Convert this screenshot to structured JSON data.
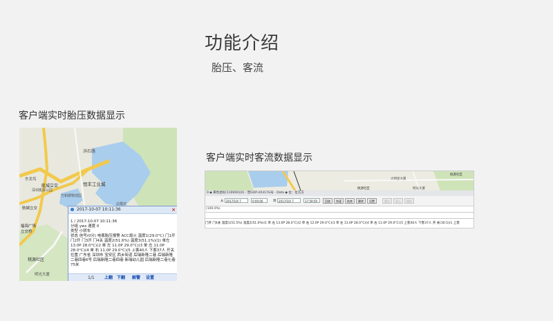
{
  "page": {
    "title": "功能介绍",
    "subtitle": "胎压、客流"
  },
  "left_panel": {
    "caption": "客户端实时胎压数据显示",
    "map_labels": [
      "洪石路",
      "东龙坞",
      "航城立交",
      "恒丰工业城",
      "万和顺物流园",
      "深圳桃源公园",
      "白鹭坊",
      "航城立交",
      "福海广场",
      "立交桥",
      "桃源社区",
      "明光大厦"
    ],
    "popup": {
      "header": "2017-10-07 10:11:36",
      "close_glyph": "×",
      "lines": [
        "1 / 2017-10-07 10:11:36",
        "分组 yws 速度 0",
        "类型 小轿车",
        "状态 信号(0分) 电瓶胎压报警 ACC熄火 温度1(29.0°C) 门1开 门2开 门3开 门4关 温度2(51.6%) 温度3(51.1%)(1) 单左 13.0P 28.0°C)(2 单 左 11.0P 29.0°C)(3 单 左 11.0P 28.0°C)(4 单 右 11.0P 29.0°C)(5 上客40人 下客37人 开关",
        "位置 广东省 深圳市 宝安区 西乡街道 后瑞新隆二巷 后瑞新隆二巷四巷6号 后瑞新隆二巷四巷 新瑞幼儿园 后瑞新隆二巷七巷75米"
      ],
      "footer": {
        "page": "1/1",
        "prev": "上翻",
        "next": "下翻",
        "dismiss": "解警",
        "settings": "设置"
      }
    }
  },
  "right_panel": {
    "caption": "客户端实时客流数据显示",
    "map_labels": [
      "桃源社区",
      "大明星大厦",
      "明光大厦",
      "桃源社区"
    ],
    "status_text": "0 ◆ 黄色坐标(110000)(0) - 塑GOP-20317G号 - Data ◆ 位：位方方",
    "toolbar": {
      "from_label": "从",
      "from_date": "2017/10/ 7",
      "from_time": "0:00:00",
      "to_label": "到",
      "to_date": "2017/10/ 7",
      "to_time": "17:59:59",
      "buttons": [
        "回放",
        "快速",
        "结束",
        "删除",
        "设置"
      ],
      "disabled_buttons": [
        "复位",
        "导入",
        "保存"
      ]
    },
    "percent": "(100.0%)",
    "data_line": "门开 门4关 温度1(51.5%) 温度2(51.0%)(1 单 左 13.0P 28.0°C)(2 单 右 12.0P 29.0°C)(3 单 左 13.0P 28.0°C)(4 单 右 11.0P 29.0°C)(5 上客40人 下客37人 开 关(30.5)(1 上客"
  }
}
